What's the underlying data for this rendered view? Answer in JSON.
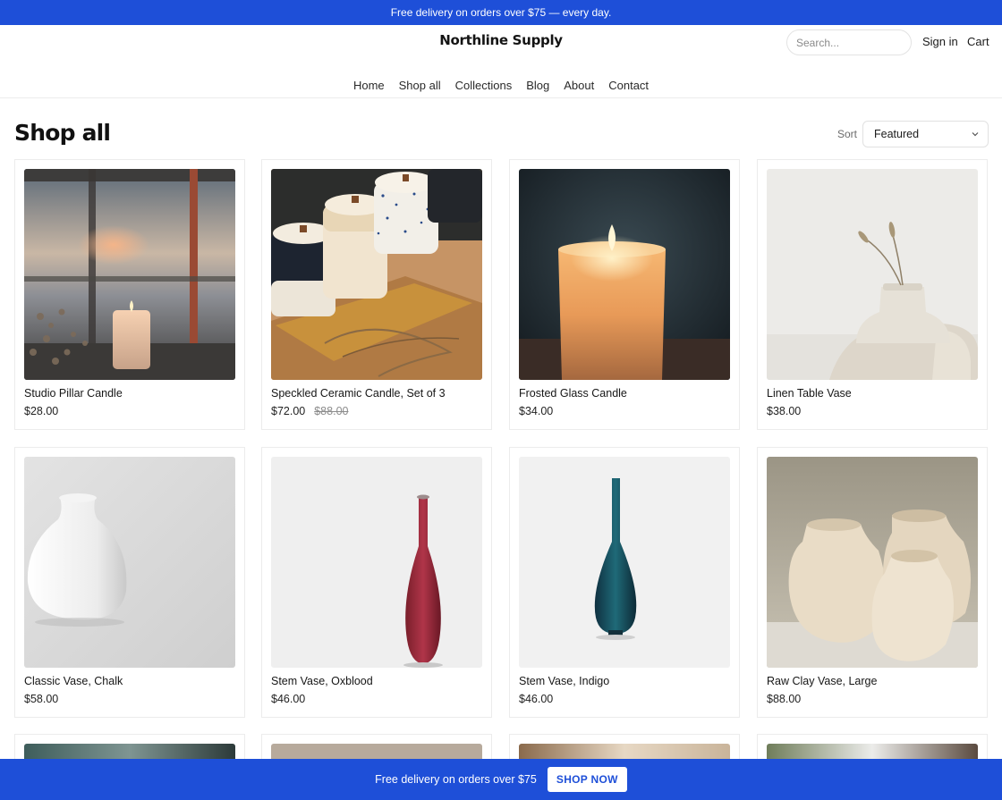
{
  "announcement": {
    "text": "Free delivery on orders over $75 — every day."
  },
  "header": {
    "brand": "Northline Supply",
    "search_placeholder": "Search...",
    "sign_in": "Sign in",
    "cart": "Cart"
  },
  "nav": {
    "items": [
      "Home",
      "Shop all",
      "Collections",
      "Blog",
      "About",
      "Contact"
    ]
  },
  "page": {
    "title": "Shop all"
  },
  "sort": {
    "label": "Sort",
    "selected": "Featured"
  },
  "products": [
    {
      "name": "Studio Pillar Candle",
      "price": "$28.00",
      "image": "candle-window-photo"
    },
    {
      "name": "Speckled Ceramic Candle, Set of 3",
      "price": "$72.00",
      "compare_price": "$88.00",
      "image": "ceramic-candles-photo"
    },
    {
      "name": "Frosted Glass Candle",
      "price": "$34.00",
      "image": "glass-candle-photo"
    },
    {
      "name": "Linen Table Vase",
      "price": "$38.00",
      "image": "linen-vase-photo"
    },
    {
      "name": "Classic Vase, Chalk",
      "price": "$58.00",
      "image": "chalk-vase-photo"
    },
    {
      "name": "Stem Vase, Oxblood",
      "price": "$46.00",
      "image": "oxblood-vase-photo"
    },
    {
      "name": "Stem Vase, Indigo",
      "price": "$46.00",
      "image": "indigo-vase-photo"
    },
    {
      "name": "Raw Clay Vase, Large",
      "price": "$88.00",
      "image": "raw-clay-vases-photo"
    }
  ],
  "sticky_bar": {
    "text": "Free delivery on orders over $75",
    "button": "SHOP NOW"
  },
  "colors": {
    "accent": "#1e4fd8",
    "text": "#1a1a1a",
    "muted": "#8c8c8c",
    "border": "#ececec"
  }
}
